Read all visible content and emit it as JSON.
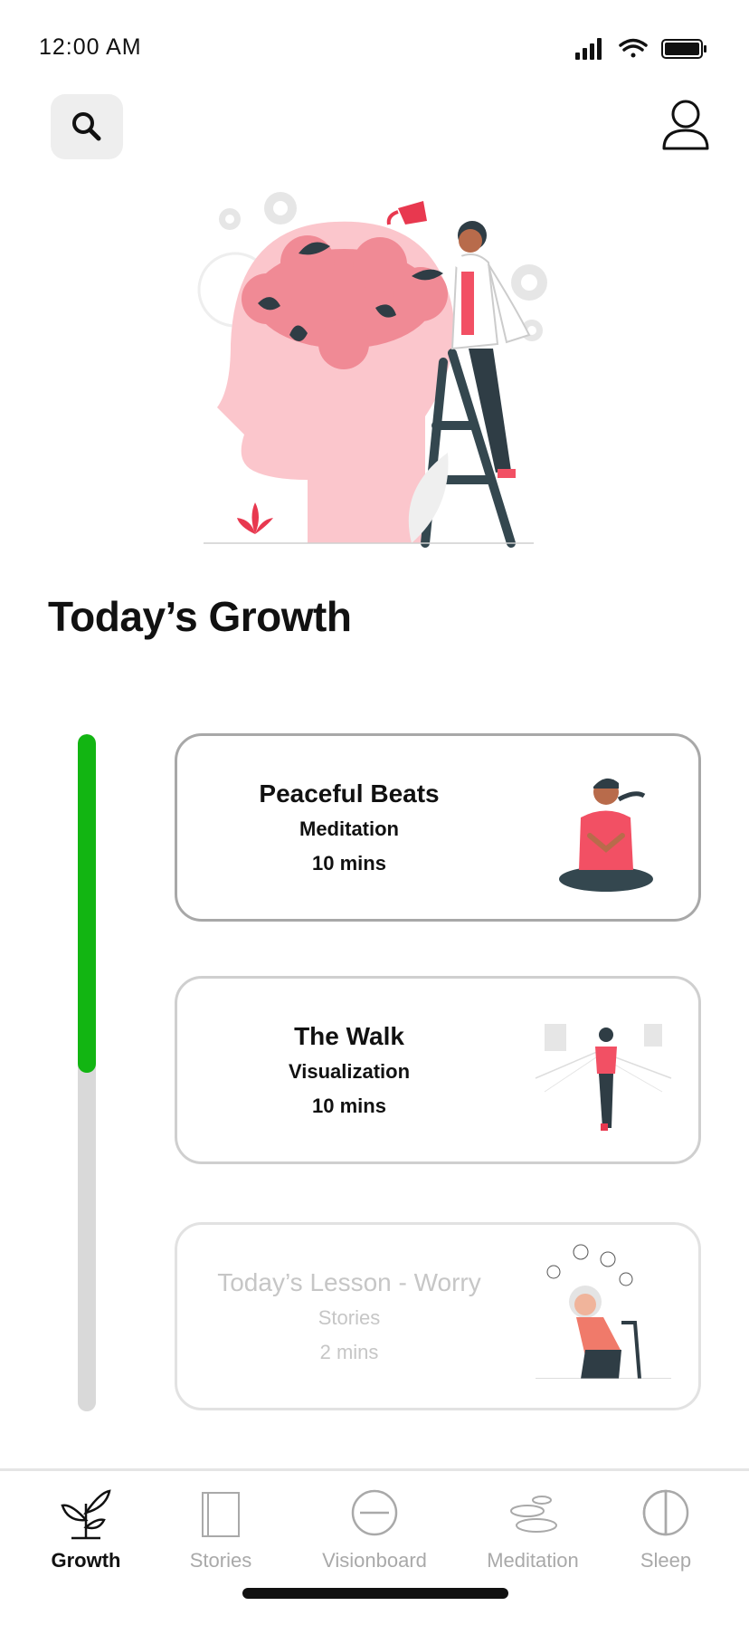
{
  "status": {
    "time": "12:00 AM"
  },
  "header": {
    "search_icon": "search-icon",
    "profile_icon": "user-icon"
  },
  "section_title": "Today’s Growth",
  "progress": {
    "fraction": 0.5
  },
  "cards": [
    {
      "title": "Peaceful Beats",
      "category": "Meditation",
      "duration": "10 mins",
      "state": "active"
    },
    {
      "title": "The Walk",
      "category": "Visualization",
      "duration": "10 mins",
      "state": "normal"
    },
    {
      "title": "Today’s Lesson - Worry",
      "category": "Stories",
      "duration": "2 mins",
      "state": "locked"
    }
  ],
  "nav": {
    "items": [
      {
        "label": "Growth",
        "icon": "plant-icon",
        "active": true
      },
      {
        "label": "Stories",
        "icon": "book-icon",
        "active": false
      },
      {
        "label": "Visionboard",
        "icon": "visionboard-icon",
        "active": false
      },
      {
        "label": "Meditation",
        "icon": "stones-icon",
        "active": false
      },
      {
        "label": "Sleep",
        "icon": "moon-icon",
        "active": false
      }
    ]
  },
  "colors": {
    "accent_green": "#12b512",
    "track_grey": "#d9d9d9",
    "illustration_pink": "#f08a95",
    "illustration_dark": "#2f3d45"
  }
}
